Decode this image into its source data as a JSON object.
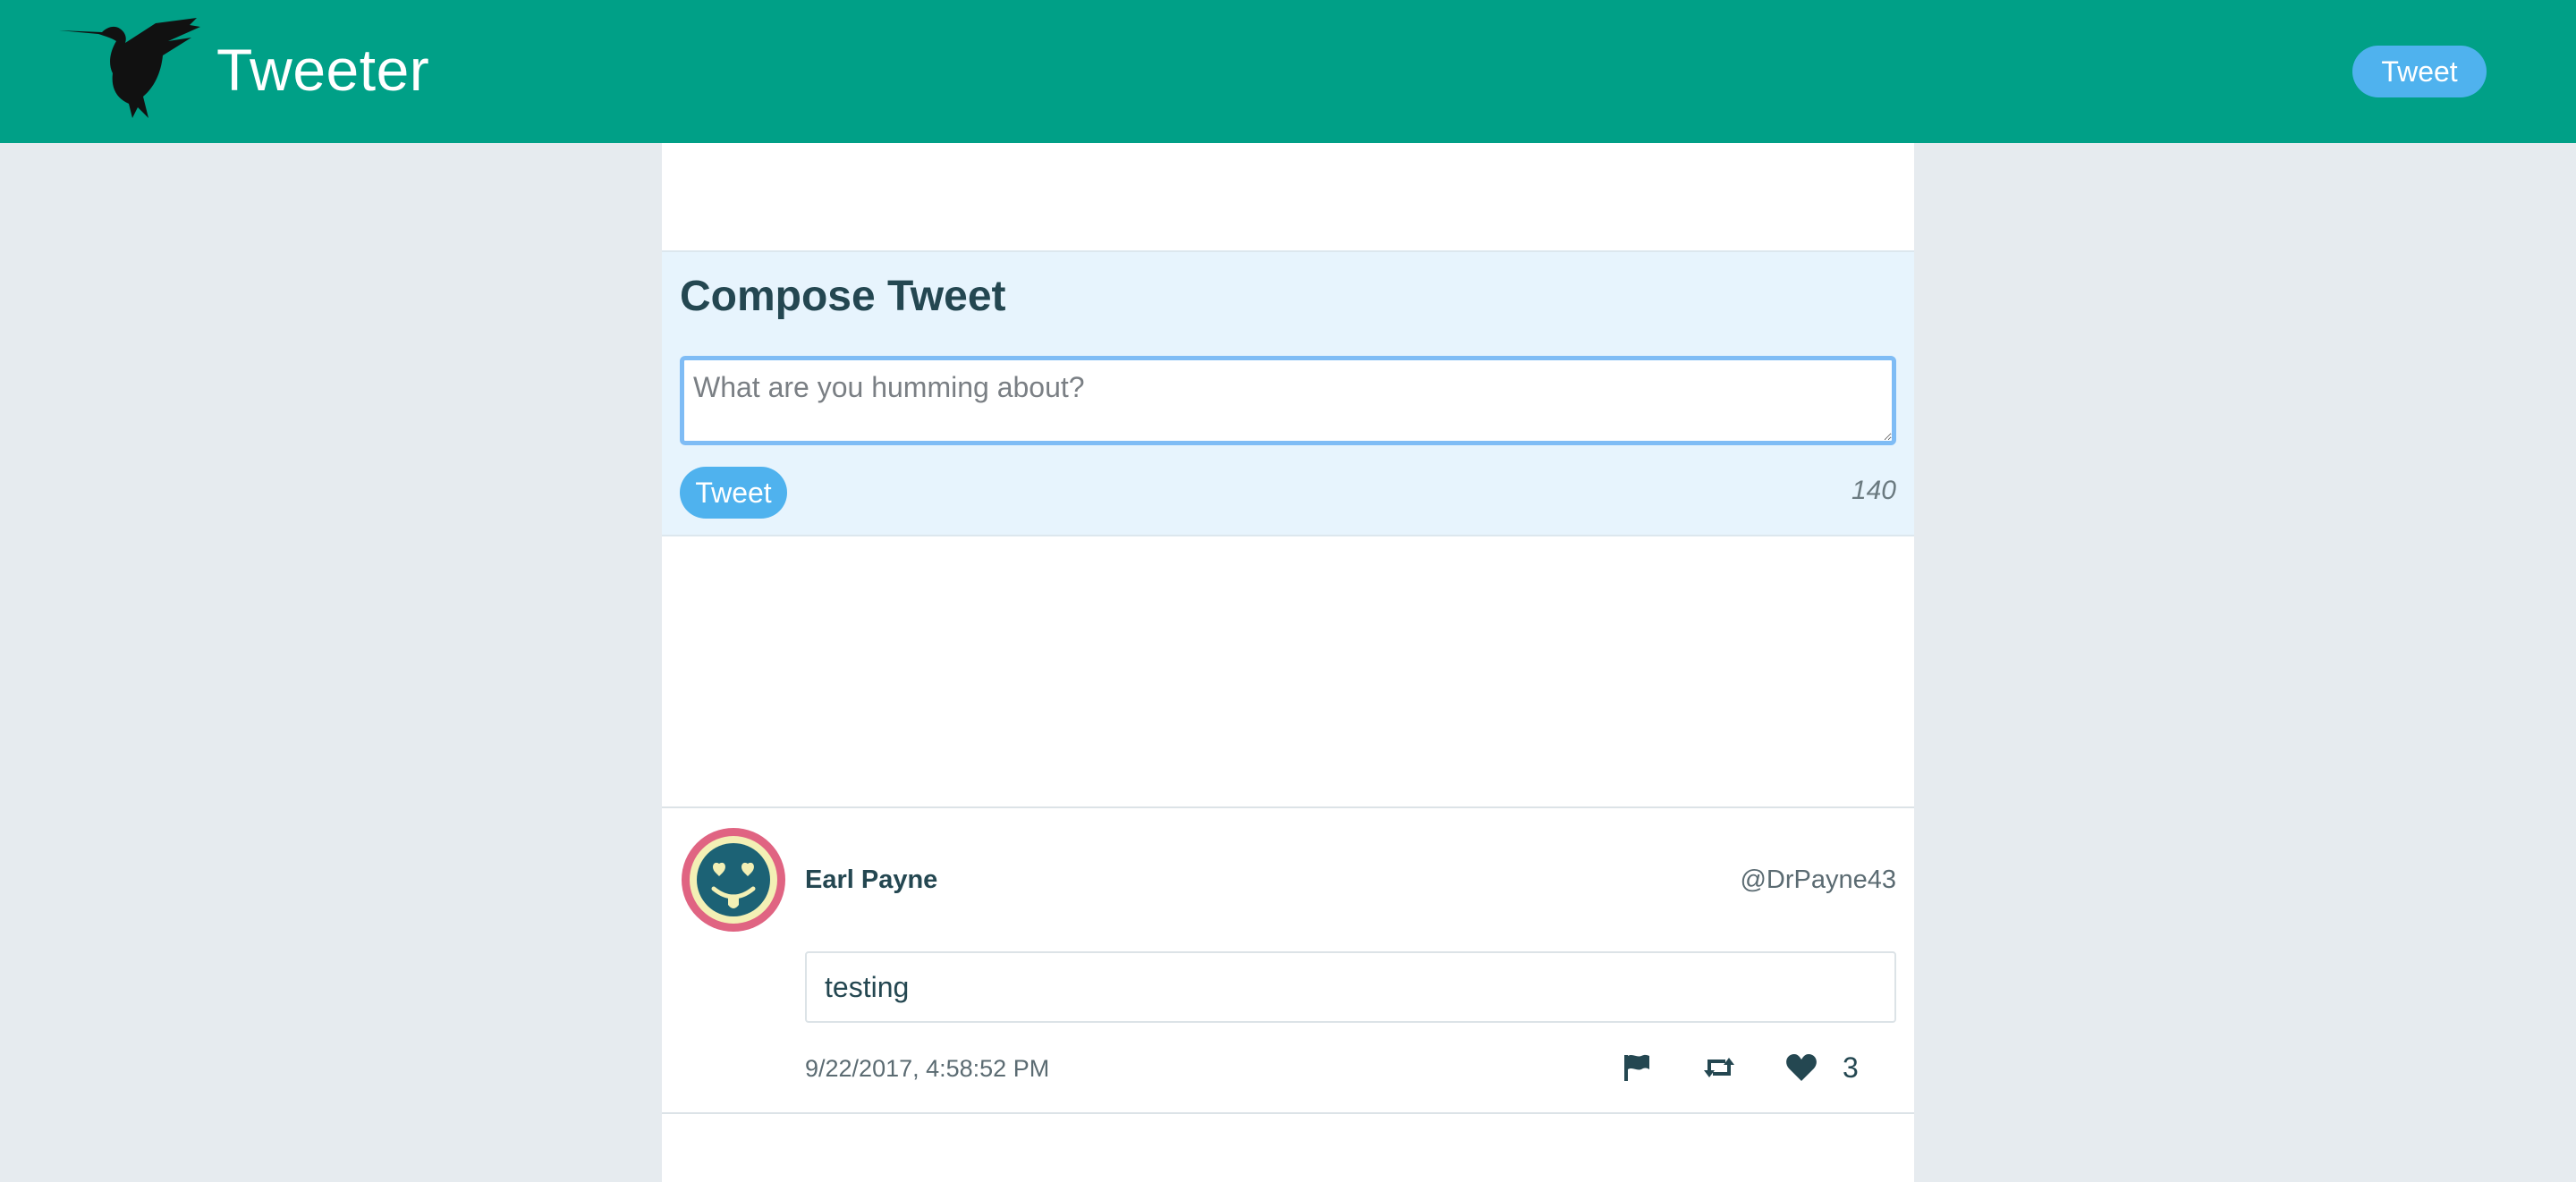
{
  "header": {
    "app_title": "Tweeter",
    "tweet_button_label": "Tweet",
    "logo_icon": "hummingbird-icon"
  },
  "compose": {
    "title": "Compose Tweet",
    "placeholder": "What are you humming about?",
    "value": "",
    "tweet_button_label": "Tweet",
    "char_counter": "140"
  },
  "tweets": [
    {
      "name": "Earl Payne",
      "handle": "@DrPayne43",
      "content": "testing",
      "timestamp": "9/22/2017, 4:58:52 PM",
      "likes": "3",
      "avatar_icon": "heart-eyes-face-icon",
      "actions": [
        "flag-icon",
        "retweet-icon",
        "heart-icon"
      ]
    }
  ],
  "colors": {
    "header_bg": "#00a087",
    "accent_blue": "#4fb2ee",
    "compose_bg": "#e7f4fd",
    "page_bg": "#e6ebef",
    "text": "#244751"
  }
}
